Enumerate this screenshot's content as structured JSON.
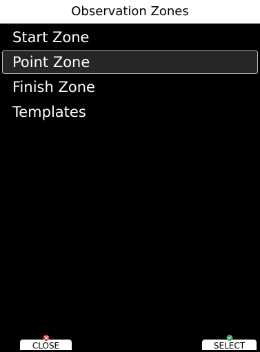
{
  "header": {
    "title": "Observation Zones"
  },
  "menu": {
    "items": [
      {
        "label": "Start Zone",
        "selected": false
      },
      {
        "label": "Point Zone",
        "selected": true
      },
      {
        "label": "Finish Zone",
        "selected": false
      },
      {
        "label": "Templates",
        "selected": false
      }
    ]
  },
  "softkeys": {
    "close": {
      "label": "CLOSE",
      "icon": "close-icon",
      "icon_color": "#d9363e"
    },
    "select": {
      "label": "SELECT",
      "icon": "check-icon",
      "icon_color": "#3aa655"
    }
  },
  "colors": {
    "background": "#000000",
    "title_bg": "#ffffff",
    "selected_bg": "#262626",
    "selected_border": "#bfbfbf",
    "text": "#ffffff"
  }
}
